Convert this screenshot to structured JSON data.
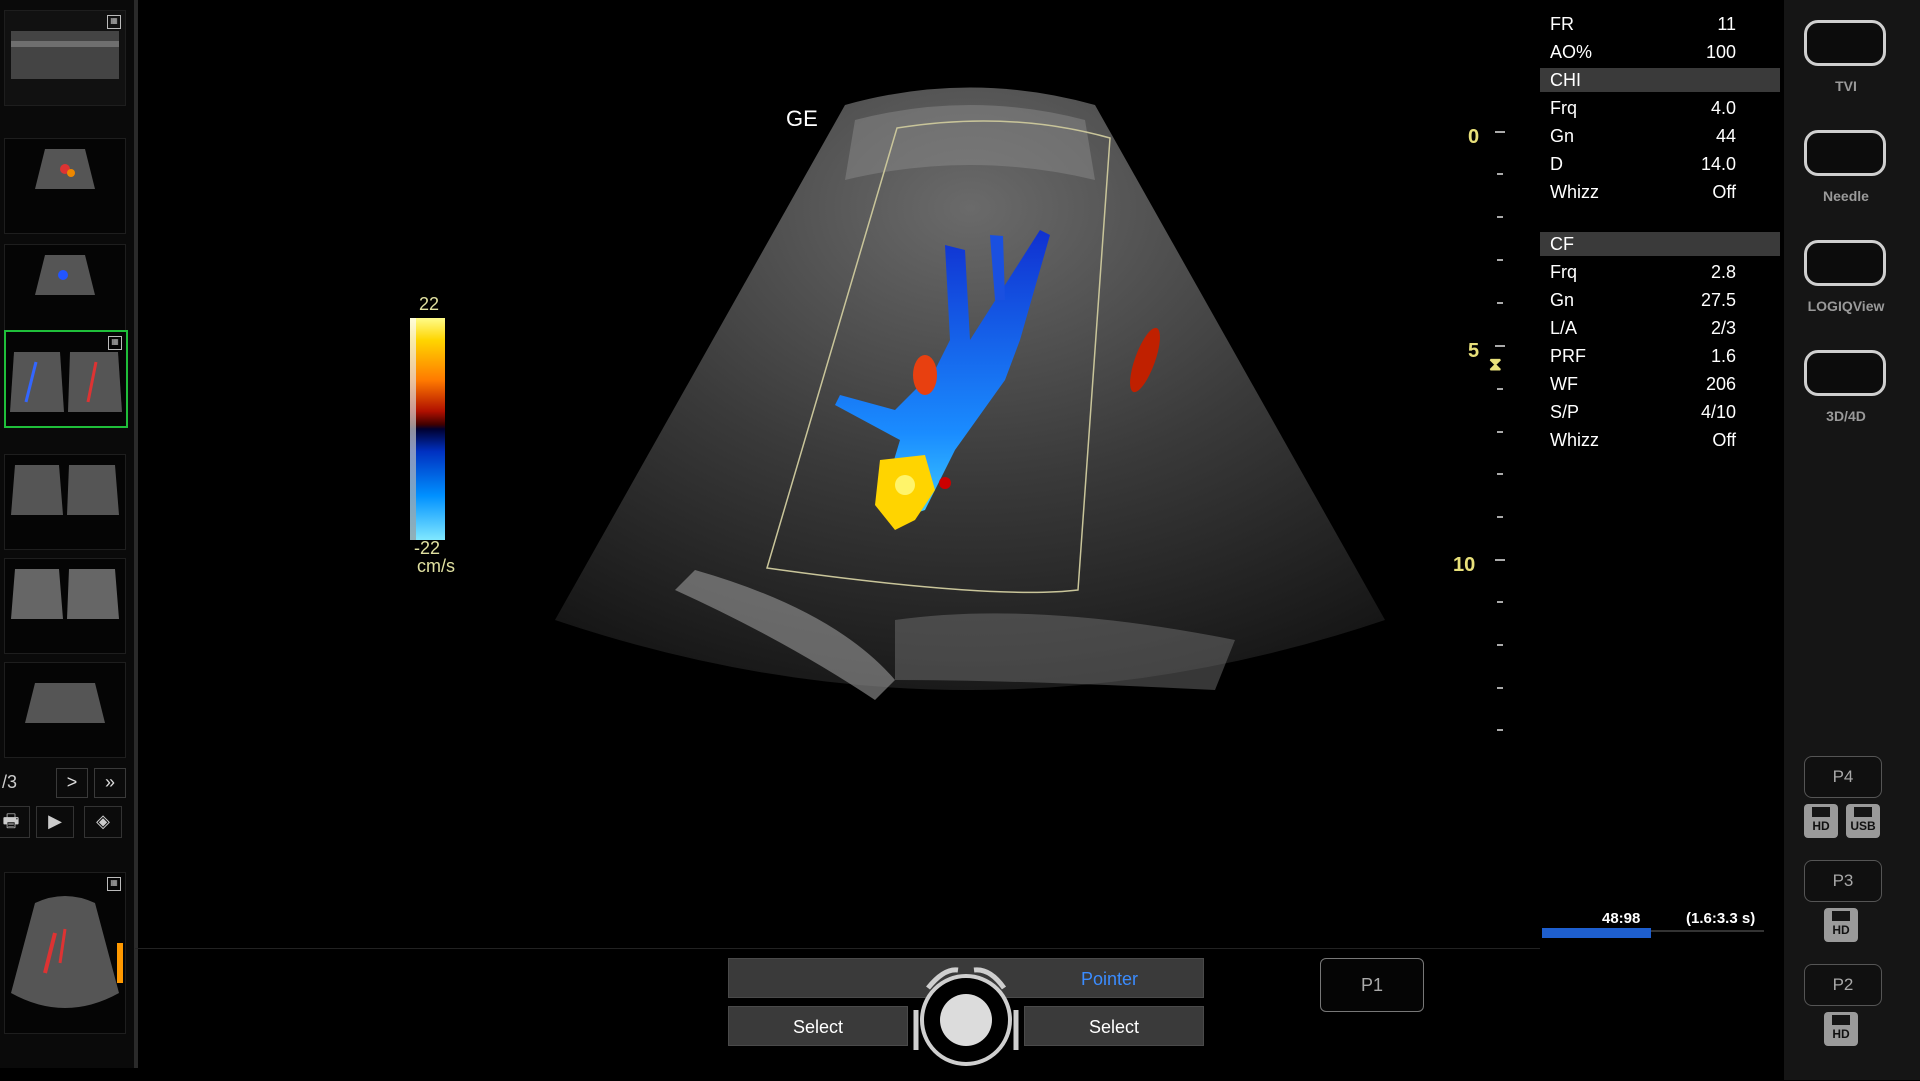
{
  "annotation": {
    "ge_label": "GE"
  },
  "colorbar": {
    "top_value": "22",
    "bottom_value": "-22",
    "unit": "cm/s"
  },
  "depth_scale": {
    "labels": [
      "0",
      "5",
      "10"
    ]
  },
  "parameters": {
    "general": [
      {
        "label": "FR",
        "value": "11"
      },
      {
        "label": "AO%",
        "value": "100"
      }
    ],
    "chi": {
      "header": "CHI",
      "rows": [
        {
          "label": "Frq",
          "value": "4.0"
        },
        {
          "label": "Gn",
          "value": "44"
        },
        {
          "label": "D",
          "value": "14.0"
        },
        {
          "label": "Whizz",
          "value": "Off"
        }
      ]
    },
    "cf": {
      "header": "CF",
      "rows": [
        {
          "label": "Frq",
          "value": "2.8"
        },
        {
          "label": "Gn",
          "value": "27.5"
        },
        {
          "label": "L/A",
          "value": "2/3"
        },
        {
          "label": "PRF",
          "value": "1.6"
        },
        {
          "label": "WF",
          "value": "206"
        },
        {
          "label": "S/P",
          "value": "4/10"
        },
        {
          "label": "Whizz",
          "value": "Off"
        }
      ]
    }
  },
  "right_buttons": {
    "modes": [
      "TVI",
      "Needle",
      "LOGIQView",
      "3D/4D"
    ],
    "presets": [
      "P4",
      "P3",
      "P2"
    ],
    "storage": {
      "hd": "HD",
      "usb": "USB"
    }
  },
  "cine": {
    "frame": "48:98",
    "time": "(1.6:3.3 s)",
    "progress": 0.49
  },
  "thumbnails": {
    "page_label": "/3",
    "next": ">",
    "last": "»"
  },
  "bottom_controls": {
    "pointer": "Pointer",
    "select_left": "Select",
    "select_right": "Select",
    "p1": "P1"
  },
  "colors": {
    "selection_border": "#1fbf3a",
    "pointer_text": "#3a8cff",
    "depth_text": "#e8e07a",
    "cine_fill": "#1e5fcf"
  }
}
